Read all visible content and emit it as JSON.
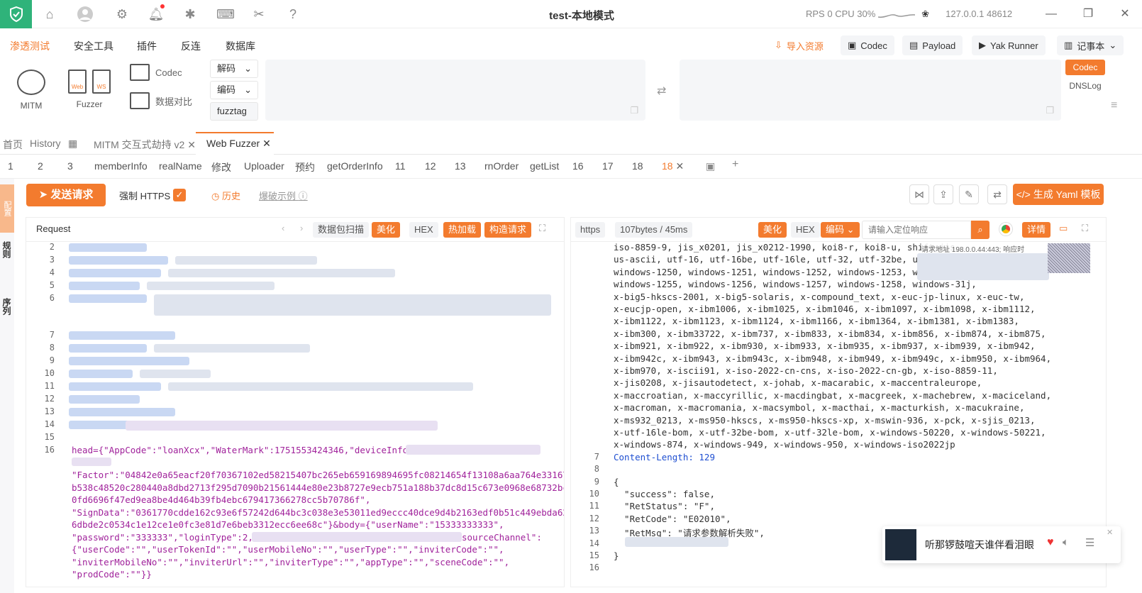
{
  "titlebar": {
    "title": "test-本地模式",
    "rps": "RPS 0",
    "cpu": "CPU 30%",
    "address": "127.0.0.1",
    "port": "48612"
  },
  "menu": {
    "items": [
      "渗透测试",
      "安全工具",
      "插件",
      "反连",
      "数据库"
    ],
    "quick": {
      "import": "导入资源",
      "codec": "Codec",
      "payload": "Payload",
      "yak_runner": "Yak Runner",
      "notebook": "记事本"
    }
  },
  "tools": {
    "mitm": "MITM",
    "fuzzer": "Fuzzer",
    "codec": "Codec",
    "compare": "数据对比",
    "decode": "解码",
    "encode": "编码",
    "fuzztag": "fuzztag",
    "side_codec": "Codec",
    "side_dnslog": "DNSLog"
  },
  "tabs_top": {
    "home": "首页",
    "history": "History",
    "mitm": "MITM 交互式劫持 v2",
    "web_fuzzer": "Web Fuzzer"
  },
  "tabs_sub": [
    "1",
    "2",
    "3",
    "memberInfo",
    "realName",
    "修改",
    "Uploader",
    "预约",
    "getOrderInfo",
    "11",
    "12",
    "13",
    "rnOrder",
    "getList",
    "16",
    "17",
    "18",
    "18"
  ],
  "rail": {
    "top": "配置",
    "rules": "规则",
    "sequence": "序列"
  },
  "actions": {
    "send": "发送请求",
    "force_https": "强制 HTTPS",
    "history": "历史",
    "example": "爆破示例",
    "yaml": "生成 Yaml 模板"
  },
  "request": {
    "title": "Request",
    "scan": "数据包扫描",
    "beautify": "美化",
    "hex": "HEX",
    "hot_load": "热加载",
    "build": "构造请求",
    "line_numbers": [
      "2",
      "3",
      "4",
      "5",
      "6",
      "7",
      "8",
      "9",
      "10",
      "11",
      "12",
      "13",
      "14",
      "15",
      "16"
    ],
    "body_lines": [
      "head={\"AppCode\":\"loanXcx\",\"WaterMark\":1751553424346,\"deviceInfo\":",
      "\"Factor\":\"04842e0a65eacf20f70367102ed58215407bc265eb659169894695fc08214654f13108a6aa764e33167",
      "b538c48520c280440a8dbd2713f295d7090b21561444e80e23b8727e9ecb751a188b37dc8d15c673e0968e68732bc",
      "0fd6696f47ed9ea8be4d464b39fb4ebc679417366278cc5b70786f\",",
      "\"SignData\":\"0361770cdde162c93e6f57242d644bc3c038e3e53011ed9eccc40dce9d4b2163edf0b51c449ebda62",
      "6dbde2c0534c1e12ce1e0fc3e81d7e6beb3312ecc6ee68c\"}&body={\"userName\":\"15333333333\",",
      "\"password\":\"333333\",\"loginType\":2,\"",
      "sourceChannel\":",
      "{\"userCode\":\"\",\"userTokenId\":\"\",\"userMobileNo\":\"\",\"userType\":\"\",\"inviterCode\":\"\",",
      "\"inviterMobileNo\":\"\",\"inviterUrl\":\"\",\"inviterType\":\"\",\"appType\":\"\",\"sceneCode\":\"\",",
      "\"prodCode\":\"\"}}"
    ]
  },
  "response": {
    "scheme": "https",
    "stats": "107bytes / 45ms",
    "beautify": "美化",
    "hex": "HEX",
    "encoding": "编码",
    "search_placeholder": "请输入定位响应",
    "details": "详情",
    "tooltip": "请求地址 198.0.0.44:443; 响应时",
    "charset_lines": [
      "iso-8859-9, jis_x0201, jis_x0212-1990, koi8-r, koi8-u, shift_jis,",
      "us-ascii, utf-16, utf-16be, utf-16le, utf-32, utf-32be, utf",
      "windows-1250, windows-1251, windows-1252, windows-1253, win",
      "windows-1255, windows-1256, windows-1257, windows-1258, windows-31j,",
      "x-big5-hkscs-2001, x-big5-solaris, x-compound_text, x-euc-jp-linux, x-euc-tw,",
      "x-eucjp-open, x-ibm1006, x-ibm1025, x-ibm1046, x-ibm1097, x-ibm1098, x-ibm1112,",
      "x-ibm1122, x-ibm1123, x-ibm1124, x-ibm1166, x-ibm1364, x-ibm1381, x-ibm1383,",
      "x-ibm300, x-ibm33722, x-ibm737, x-ibm833, x-ibm834, x-ibm856, x-ibm874, x-ibm875,",
      "x-ibm921, x-ibm922, x-ibm930, x-ibm933, x-ibm935, x-ibm937, x-ibm939, x-ibm942,",
      "x-ibm942c, x-ibm943, x-ibm943c, x-ibm948, x-ibm949, x-ibm949c, x-ibm950, x-ibm964,",
      "x-ibm970, x-iscii91, x-iso-2022-cn-cns, x-iso-2022-cn-gb, x-iso-8859-11,",
      "x-jis0208, x-jisautodetect, x-johab, x-macarabic, x-maccentraleurope,",
      "x-maccroatian, x-maccyrillic, x-macdingbat, x-macgreek, x-machebrew, x-maciceland,",
      "x-macroman, x-macromania, x-macsymbol, x-macthai, x-macturkish, x-macukraine,",
      "x-ms932_0213, x-ms950-hkscs, x-ms950-hkscs-xp, x-mswin-936, x-pck, x-sjis_0213,",
      "x-utf-16le-bom, x-utf-32be-bom, x-utf-32le-bom, x-windows-50220, x-windows-50221,",
      "x-windows-874, x-windows-949, x-windows-950, x-windows-iso2022jp"
    ],
    "numbered": [
      {
        "n": "7",
        "text": "Content-Length: 129"
      },
      {
        "n": "8",
        "text": ""
      },
      {
        "n": "9",
        "text": "{"
      },
      {
        "n": "10",
        "text": "  \"success\": false,"
      },
      {
        "n": "11",
        "text": "  \"RetStatus\": \"F\","
      },
      {
        "n": "12",
        "text": "  \"RetCode\": \"E02010\","
      },
      {
        "n": "13",
        "text": "  \"RetMsg\": \"请求参数解析失败\","
      },
      {
        "n": "14",
        "text": ""
      },
      {
        "n": "15",
        "text": "}"
      },
      {
        "n": "16",
        "text": ""
      }
    ]
  },
  "music": {
    "song": "听那锣鼓喧天谁伴看泪眼"
  },
  "colors": {
    "accent": "#f37b2e",
    "brand_green": "#2fb37a",
    "json_key": "#a0229b",
    "param_key": "#d14f1c"
  }
}
